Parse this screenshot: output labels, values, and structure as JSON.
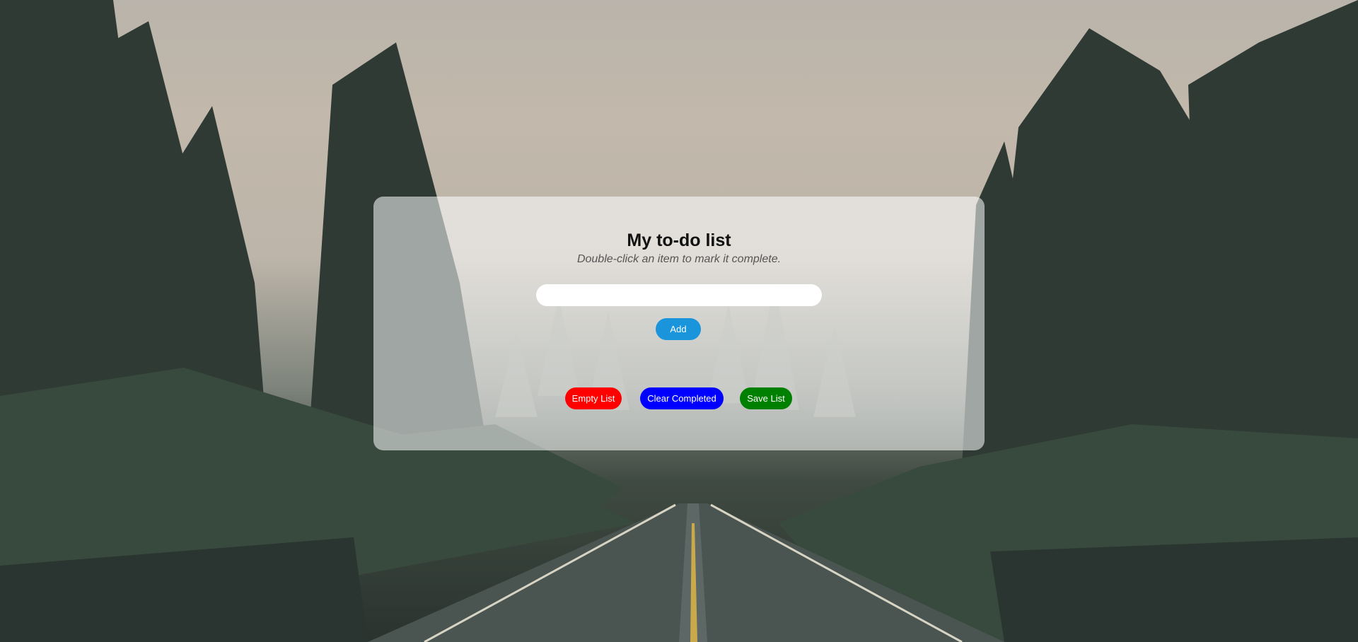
{
  "todo": {
    "title": "My to-do list",
    "subtitle": "Double-click an item to mark it complete.",
    "input": {
      "value": "",
      "placeholder": ""
    },
    "add_label": "Add",
    "actions": {
      "empty_label": "Empty List",
      "clear_label": "Clear Completed",
      "save_label": "Save List"
    }
  },
  "colors": {
    "add_button": "#1a95dc",
    "empty_button": "#ff0000",
    "clear_button": "#0000ff",
    "save_button": "#008000",
    "card_background": "rgba(255,255,255,0.55)"
  },
  "background": {
    "icon": "forest-road-photo"
  }
}
